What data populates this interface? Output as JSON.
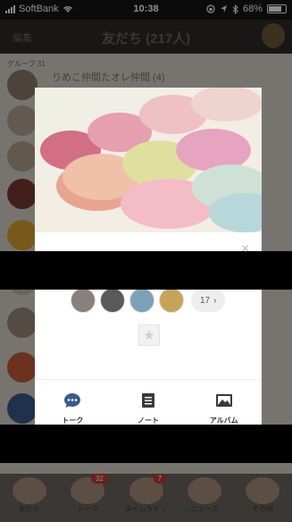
{
  "status": {
    "carrier": "SoftBank",
    "time": "10:38",
    "battery": "68%"
  },
  "header": {
    "edit_label": "編集",
    "title": "友だち (217人)"
  },
  "list": {
    "group_label": "グループ 31",
    "first_item": "りめこ仲間たオレ仲間 (4)"
  },
  "tabbar": {
    "tabs": [
      {
        "label": "友だち",
        "badge": ""
      },
      {
        "label": "トーク",
        "badge": "32"
      },
      {
        "label": "タイムライン",
        "badge": "7"
      },
      {
        "label": "ニュース",
        "badge": ""
      },
      {
        "label": "その他",
        "badge": ""
      }
    ]
  },
  "card": {
    "more_members": "17",
    "more_chevron": "›",
    "star": "★",
    "close": "×",
    "actions": [
      {
        "label": "トーク",
        "icon": "chat-icon"
      },
      {
        "label": "ノート",
        "icon": "note-icon"
      },
      {
        "label": "アルバム",
        "icon": "album-icon"
      }
    ]
  }
}
